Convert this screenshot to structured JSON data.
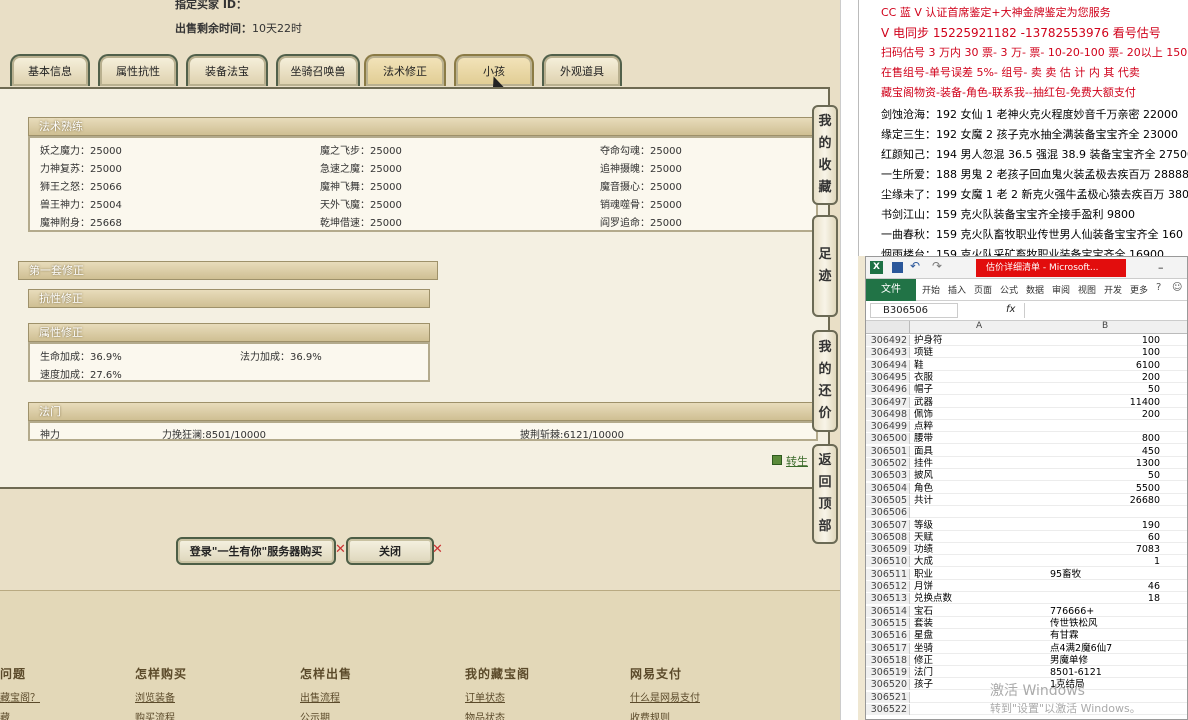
{
  "header": {
    "seller_label": "指定买家 ID：",
    "time_label": "出售剩余时间：",
    "time_value": "10天22时"
  },
  "tabs": [
    "基本信息",
    "属性抗性",
    "装备法宝",
    "坐骑召唤兽",
    "法术修正",
    "小孩",
    "外观道具"
  ],
  "spell_section": {
    "title": "法术熟练",
    "items": [
      [
        "妖之魔力：25000",
        "魔之飞步：25000",
        "夺命勾魂：25000"
      ],
      [
        "力神复苏：25000",
        "急速之魔：25000",
        "追神摄魄：25000"
      ],
      [
        "狮王之怒：25066",
        "魔神飞舞：25000",
        "魔音摄心：25000"
      ],
      [
        "兽王神力：25004",
        "天外飞魔：25000",
        "销魂噬骨：25000"
      ],
      [
        "魔神附身：25668",
        "乾坤借速：25000",
        "阎罗追命：25000"
      ]
    ]
  },
  "correction": {
    "title": "第一套修正",
    "resist_title": "抗性修正",
    "attr_title": "属性修正",
    "attrs": [
      "生命加成：36.9%",
      "法力加成：36.9%",
      "速度加成：27.6%"
    ]
  },
  "fa_men": {
    "title": "法门",
    "col1": "神力",
    "col2": "力挽狂澜:8501/10000",
    "col3": "披荆斩棘:6121/10000"
  },
  "side_buttons": [
    [
      "我",
      "的",
      "收",
      "藏"
    ],
    [
      "足",
      "迹"
    ],
    [
      "我",
      "的",
      "还",
      "价"
    ],
    [
      "返",
      "回",
      "顶",
      "部"
    ]
  ],
  "partial_link": "转生",
  "buttons": {
    "login": "登录\"一生有你\"服务器购买",
    "close": "关闭"
  },
  "footer": {
    "cols": [
      {
        "title": "问题",
        "links": [
          "藏宝阁？",
          "藏"
        ]
      },
      {
        "title": "怎样购买",
        "links": [
          "浏览装备",
          "购买流程"
        ]
      },
      {
        "title": "怎样出售",
        "links": [
          "出售流程",
          "公示期"
        ]
      },
      {
        "title": "我的藏宝阁",
        "links": [
          "订单状态",
          "物品状态"
        ]
      },
      {
        "title": "网易支付",
        "links": [
          "什么是网易支付",
          "收费规则"
        ]
      }
    ]
  },
  "right_text": [
    {
      "text": "CC 蓝 V 认证首席鉴定+大神金牌鉴定为您服务",
      "color": "#d0021b"
    },
    {
      "text": "V 电同步 15225921182 -13782553976 看号估号",
      "color": "#d0021b"
    },
    {
      "text": "扫码估号 3 万内 30 票- 3 万- 票- 10-20-100 票- 20以上 150",
      "color": "#d0021b"
    },
    {
      "text": "在售组号-单号误差 5%- 组号- 卖 卖 估 计 内 其 代卖",
      "color": "#d0021b"
    },
    {
      "text": "藏宝阁物资-装备-角色-联系我--抽红包-免费大额支付",
      "color": "#d0021b"
    },
    {
      "text": "剑蚀沧海：192 女仙 1 老神火克火程度妙音千万亲密 22000",
      "color": "#000"
    },
    {
      "text": "缘定三生：192 女魔 2 孩子克水抽全满装备宝宝齐全 23000",
      "color": "#000"
    },
    {
      "text": "红颜知己：194 男人忽混 36.5 强混 38.9 装备宝宝齐全 27500",
      "color": "#000"
    },
    {
      "text": "一生所爱：188 男鬼 2 老孩子回血鬼火装孟极去疾百万 28888",
      "color": "#000"
    },
    {
      "text": "尘缘未了：199 女魔 1 老 2 新克火强牛孟极心猿去疾百万 380",
      "color": "#000"
    },
    {
      "text": "书剑江山：159 克火队装备宝宝齐全接手盈利 9800",
      "color": "#000"
    },
    {
      "text": "一曲春秋：159 克火队畜牧职业传世男人仙装备宝宝齐全 160",
      "color": "#000"
    },
    {
      "text": "烟雨楼台：159 克火队采矿畜牧职业装备宝宝齐全 16900",
      "color": "#000"
    }
  ],
  "excel": {
    "title": "估价详细清单 - Microsoft...",
    "tab_file": "文件",
    "ribbon": [
      "开始",
      "插入",
      "页面",
      "公式",
      "数据",
      "审阅",
      "视图",
      "开发",
      "更多"
    ],
    "cell_ref": "B306506",
    "fx": "fx",
    "col_a": "A",
    "col_b": "B",
    "rows": [
      [
        "306492",
        "护身符",
        "100"
      ],
      [
        "306493",
        "项链",
        "100"
      ],
      [
        "306494",
        "鞋",
        "6100"
      ],
      [
        "306495",
        "衣服",
        "200"
      ],
      [
        "306496",
        "帽子",
        "50"
      ],
      [
        "306497",
        "武器",
        "11400"
      ],
      [
        "306498",
        "佩饰",
        "200"
      ],
      [
        "306499",
        "点粹",
        ""
      ],
      [
        "306500",
        "腰带",
        "800"
      ],
      [
        "306501",
        "面具",
        "450"
      ],
      [
        "306502",
        "挂件",
        "1300"
      ],
      [
        "306503",
        "披风",
        "50"
      ],
      [
        "306504",
        "角色",
        "5500"
      ],
      [
        "306505",
        "共计",
        "26680"
      ],
      [
        "306506",
        "",
        ""
      ],
      [
        "306507",
        "等级",
        "190"
      ],
      [
        "306508",
        "天赋",
        "60"
      ],
      [
        "306509",
        "功绩",
        "7083"
      ],
      [
        "306510",
        "大成",
        "1"
      ],
      [
        "306511",
        "职业",
        "95畜牧"
      ],
      [
        "306512",
        "月饼",
        "46"
      ],
      [
        "306513",
        "兑换点数",
        "18"
      ],
      [
        "306514",
        "宝石",
        "776666+"
      ],
      [
        "306515",
        "套装",
        "传世铁松风"
      ],
      [
        "306516",
        "星盘",
        "有甘霖"
      ],
      [
        "306517",
        "坐骑",
        "点4满2魔6仙7"
      ],
      [
        "306518",
        "修正",
        "男魔单修"
      ],
      [
        "306519",
        "法门",
        "8501-6121"
      ],
      [
        "306520",
        "孩子",
        "1克结局"
      ],
      [
        "306521",
        "",
        ""
      ],
      [
        "306522",
        "",
        ""
      ]
    ]
  },
  "watermark": {
    "line1": "激活 Windows",
    "line2": "转到\"设置\"以激活 Windows。"
  }
}
